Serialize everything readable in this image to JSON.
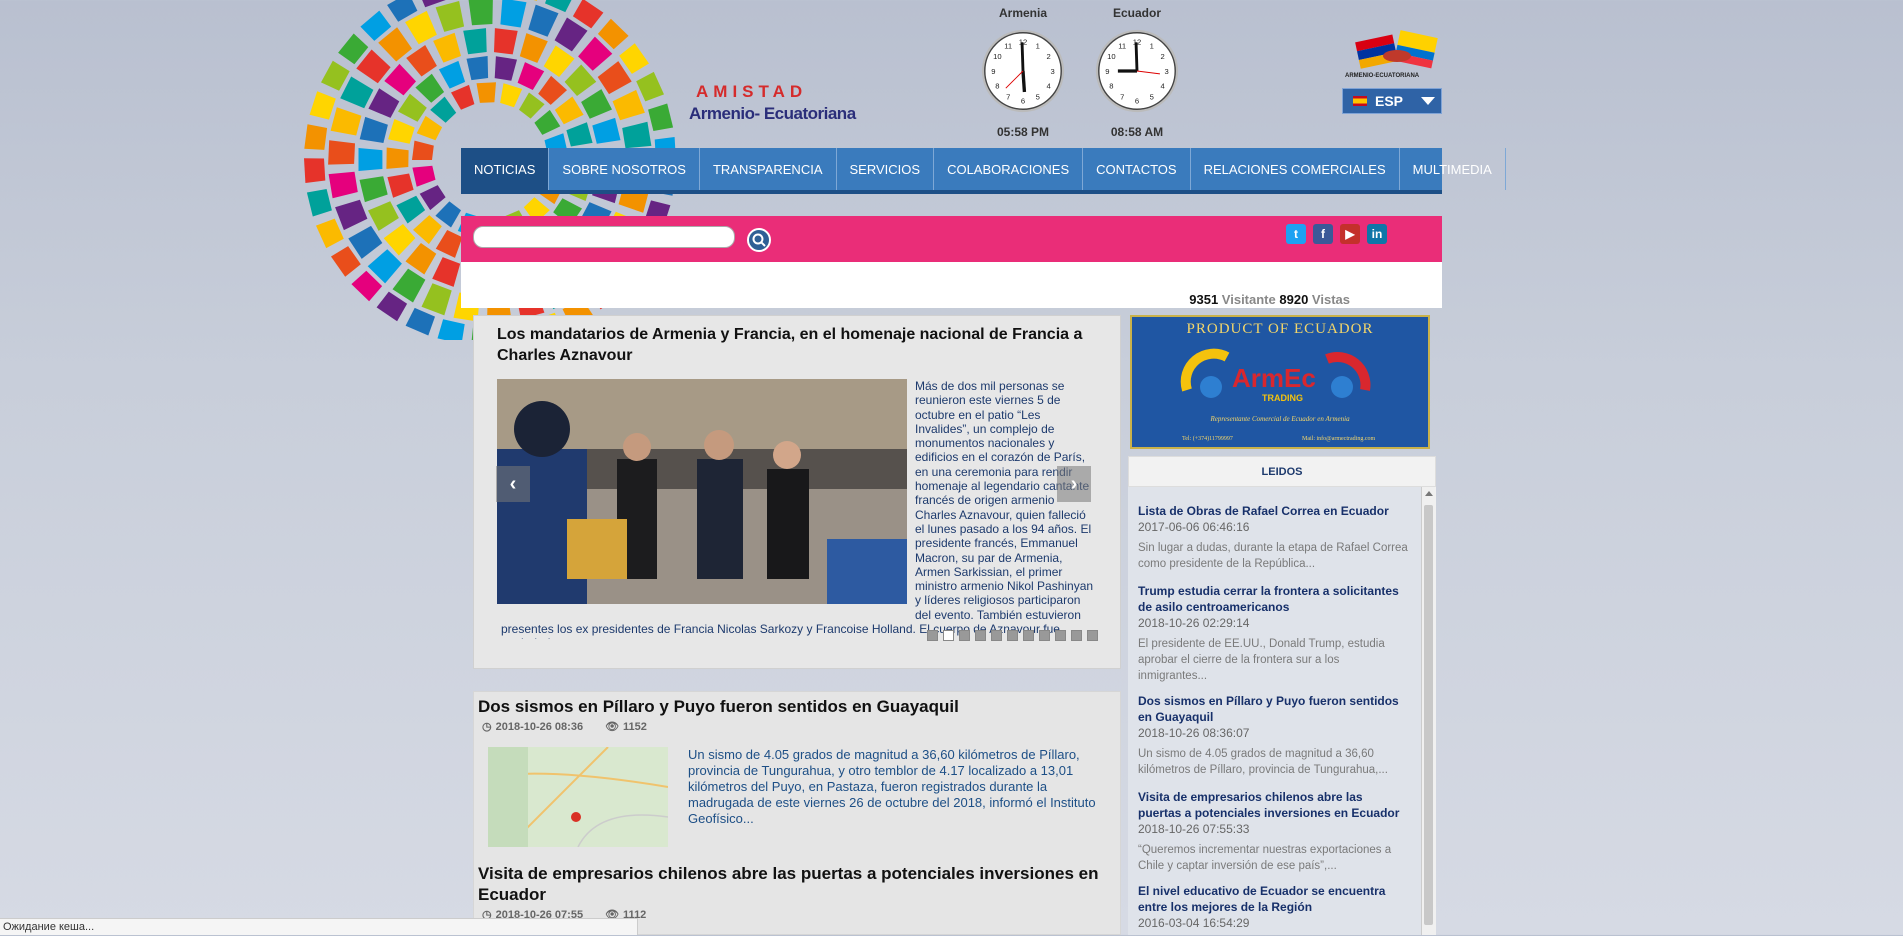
{
  "logo": {
    "line1": "AMISTAD",
    "line2": "Armenio- Ecuatoriana"
  },
  "clocks": [
    {
      "city": "Armenia",
      "time": "05:58 PM"
    },
    {
      "city": "Ecuador",
      "time": "08:58 AM"
    }
  ],
  "flags_caption": "ARMENIO-ECUATORIANA",
  "language": {
    "selected": "ESP"
  },
  "nav": [
    "NOTICIAS",
    "SOBRE NOSOTROS",
    "TRANSPARENCIA",
    "SERVICIOS",
    "COLABORACIONES",
    "CONTACTOS",
    "RELACIONES COMERCIALES",
    "MULTIMEDIA"
  ],
  "search": {
    "placeholder": "",
    "value": ""
  },
  "social": [
    "twitter-icon",
    "facebook-icon",
    "youtube-icon",
    "linkedin-icon"
  ],
  "counter": {
    "visitors": "9351",
    "visitors_label": "Visitante",
    "views": "8920",
    "views_label": "Vistas"
  },
  "featured": {
    "title": "Los mandatarios de Armenia y Francia, en el homenaje nacional de Francia a Charles Aznavour",
    "text": "Más de dos mil personas se reunieron este viernes 5 de octubre en el patio “Les Invalides”, un complejo de monumentos nacionales y edificios en el corazón de París, en una ceremonia para rendir homenaje al legendario cantante francés de origen armenio Charles Aznavour, quien falleció el lunes pasado a los 94 años. El presidente francés, Emmanuel Macron, su par de Armenia, Armen Sarkissian, el primer ministro armenio Nikol Pashinyan y líderes religiosos participaron del evento. También estuvieron presentes los ex presidentes de Francia Nicolas Sarkozy y Francoise Holland. El cuerpo de Aznavour fue trasladado",
    "prev": "‹",
    "next": "›",
    "active_slide": 2,
    "slide_count": 11
  },
  "articles": [
    {
      "title": "Dos sismos en Píllaro y Puyo fueron sentidos en Guayaquil",
      "date": "2018-10-26 08:36",
      "views": "1152",
      "text": "Un sismo de 4.05 grados de magnitud a 36,60 kilómetros de Píllaro, provincia de Tungurahua, y otro temblor de 4.17 localizado a 13,01 kilómetros del Puyo, en Pastaza, fueron registrados durante la madrugada de este viernes 26 de octubre del 2018, informó el Instituto Geofísico..."
    },
    {
      "title": "Visita de empresarios chilenos abre las puertas a potenciales inversiones en Ecuador",
      "date": "2018-10-26 07:55",
      "views": "1112",
      "text": ""
    }
  ],
  "banner": {
    "line1": "PRODUCT   OF   ECUADOR",
    "brand": "ArmEc",
    "brand_sub": "TRADING",
    "line2": "Representante Comercial de Ecuador en Armenia",
    "phone": "Tel: (+374)11799997",
    "mail": "Mail: info@armectrading.com"
  },
  "leidos": {
    "heading": "LEIDOS",
    "items": [
      {
        "title": "Lista de Obras de Rafael Correa en Ecuador",
        "date": "2017-06-06 06:46:16",
        "excerpt": "  Sin lugar a dudas, durante la etapa de Rafael Correa como presidente de la República..."
      },
      {
        "title": "Trump estudia cerrar la frontera a solicitantes de asilo centroamericanos",
        "date": "2018-10-26 02:29:14",
        "excerpt": "  El presidente de EE.UU., Donald Trump, estudia aprobar el cierre de la frontera sur a los inmigrantes..."
      },
      {
        "title": "Dos sismos en Píllaro y Puyo fueron sentidos en Guayaquil",
        "date": "2018-10-26 08:36:07",
        "excerpt": "Un sismo de 4.05 grados de magnitud a 36,60 kilómetros de Píllaro, provincia de Tungurahua,..."
      },
      {
        "title": "Visita de empresarios chilenos abre las puertas a potenciales inversiones en Ecuador",
        "date": "2018-10-26 07:55:33",
        "excerpt": "“Queremos incrementar nuestras exportaciones a Chile y captar inversión de ese país”,..."
      },
      {
        "title": "El nivel educativo de Ecuador se encuentra entre los mejores de la Región",
        "date": "2016-03-04 16:54:29",
        "excerpt": ""
      }
    ]
  },
  "status_bar": "Ожидание кеша..."
}
